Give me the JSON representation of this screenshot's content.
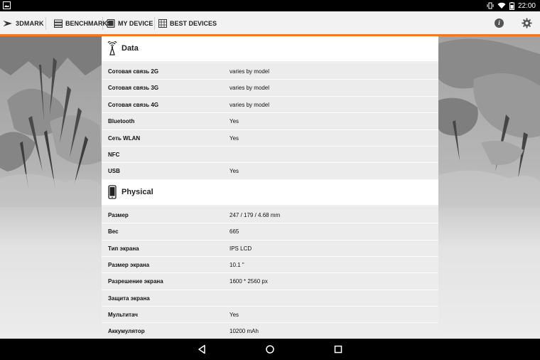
{
  "status_bar": {
    "time": "22:00"
  },
  "app": {
    "brand": "3DMARK",
    "tabs": [
      {
        "label": "BENCHMARKS"
      },
      {
        "label": "MY DEVICE"
      },
      {
        "label": "BEST DEVICES"
      }
    ]
  },
  "sections": {
    "data": {
      "title": "Data",
      "rows": [
        {
          "label": "Сотовая связь 2G",
          "value": "varies by model"
        },
        {
          "label": "Сотовая связь 3G",
          "value": "varies by model"
        },
        {
          "label": "Сотовая связь 4G",
          "value": "varies by model"
        },
        {
          "label": "Bluetooth",
          "value": "Yes"
        },
        {
          "label": "Сеть WLAN",
          "value": "Yes"
        },
        {
          "label": "NFC",
          "value": ""
        },
        {
          "label": "USB",
          "value": "Yes"
        }
      ]
    },
    "physical": {
      "title": "Physical",
      "rows": [
        {
          "label": "Размер",
          "value": "247 / 179 / 4.68 mm"
        },
        {
          "label": "Вес",
          "value": "665"
        },
        {
          "label": "Тип экрана",
          "value": "IPS LCD"
        },
        {
          "label": "Размер экрана",
          "value": "10.1 \""
        },
        {
          "label": "Разрешение экрана",
          "value": "1600 * 2560 px"
        },
        {
          "label": "Защита экрана",
          "value": ""
        },
        {
          "label": "Мультитач",
          "value": "Yes"
        },
        {
          "label": "Аккумулятор",
          "value": "10200 mAh"
        }
      ]
    }
  }
}
